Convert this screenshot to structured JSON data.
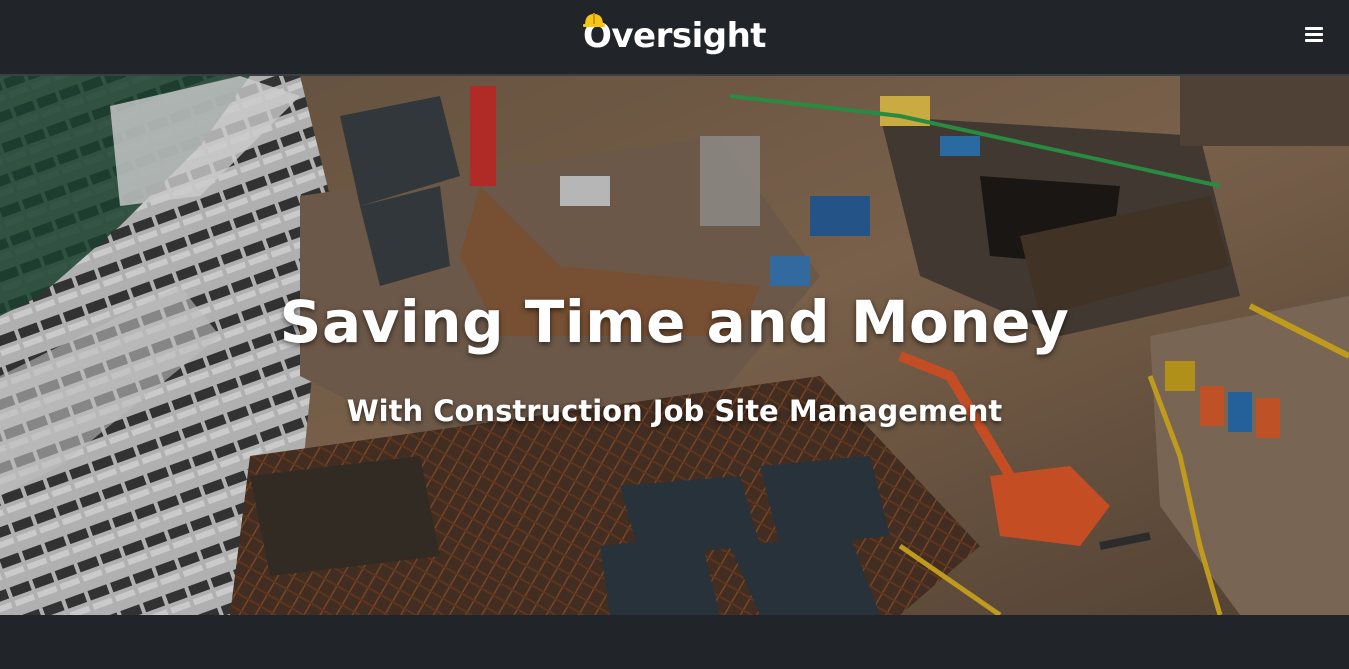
{
  "navbar": {
    "brand": "Oversight",
    "logo_icon": "hardhat-icon",
    "menu_icon": "hamburger-menu-icon"
  },
  "hero": {
    "title": "Saving Time and Money",
    "subtitle": "With Construction Job Site Management",
    "background_image": "construction-site-aerial-photo"
  },
  "colors": {
    "nav_bg": "#212529",
    "brand_accent": "#f5c518",
    "text": "#ffffff"
  }
}
